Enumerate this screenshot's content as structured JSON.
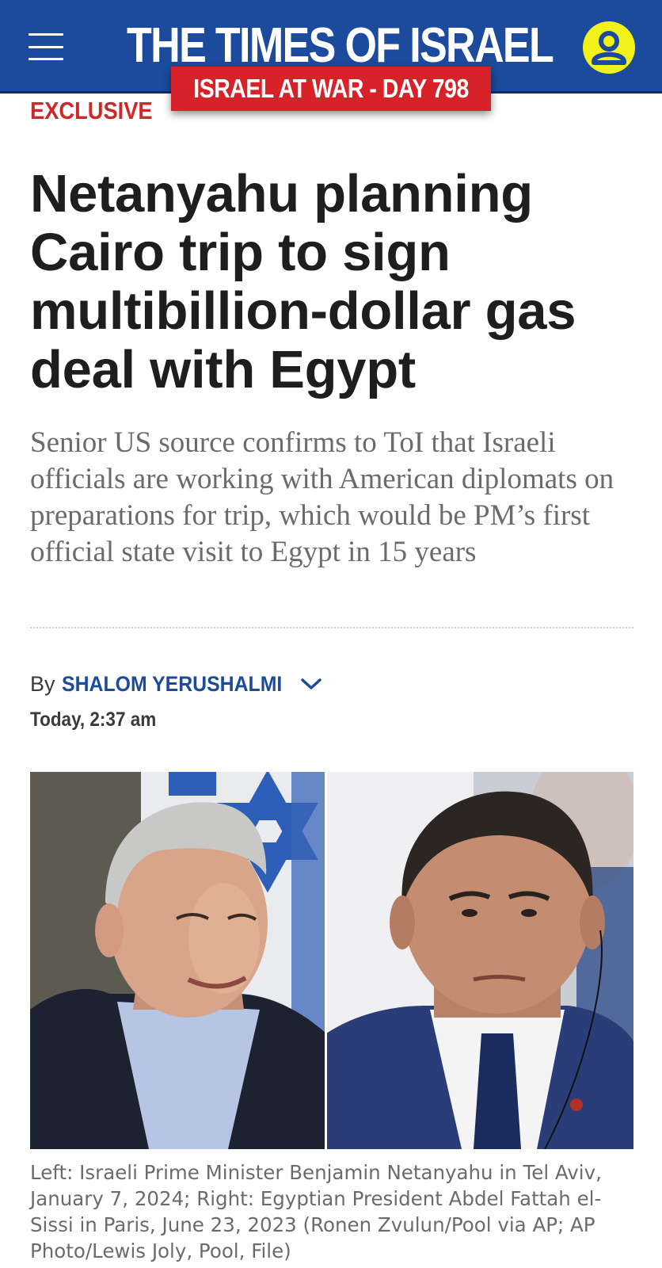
{
  "header": {
    "logo_text": "THE TIMES OF ISRAEL",
    "menu_icon": "hamburger-menu-icon",
    "account_icon": "user-account-icon",
    "brand_color": "#1c4a9c",
    "accent_color": "#f2f21a"
  },
  "banner": {
    "text": "ISRAEL AT WAR - DAY 798",
    "color": "#d8222a"
  },
  "article": {
    "kicker": "EXCLUSIVE",
    "headline": "Netanyahu planning Cairo trip to sign multibillion-dollar gas deal with Egypt",
    "subheadline": "Senior US source confirms to ToI that Israeli officials are working with American diplomats on preparations for trip, which would be PM’s first official state visit to Egypt in 15 years",
    "byline_prefix": "By",
    "author": "SHALOM YERUSHALMI",
    "timestamp": "Today, 2:37 am",
    "image_caption": "Left: Israeli Prime Minister Benjamin Netanyahu in Tel Aviv, January 7, 2024; Right: Egyptian President Abdel Fattah el-Sissi in Paris, June 23, 2023 (Ronen Zvulun/Pool via AP; AP Photo/Lewis Joly, Pool, File)"
  }
}
